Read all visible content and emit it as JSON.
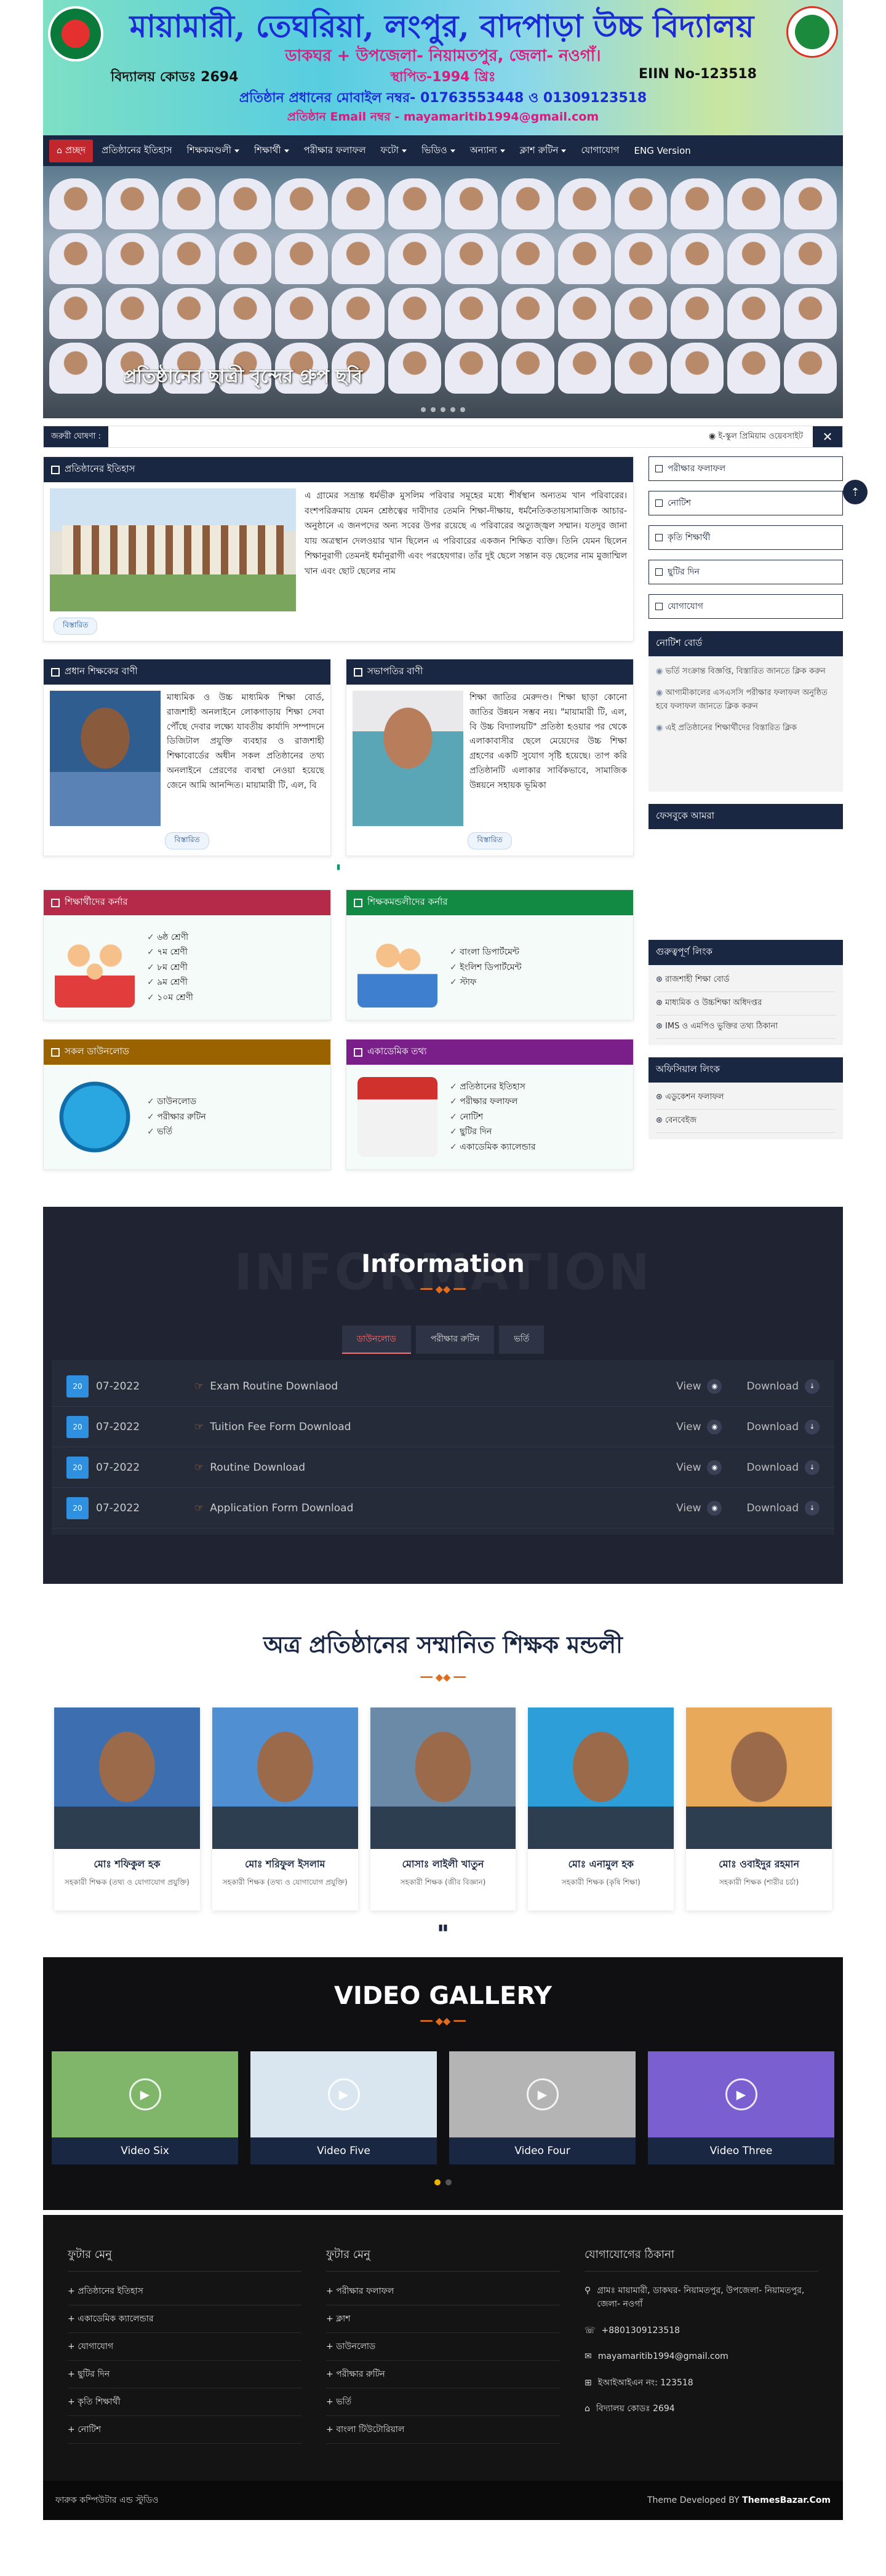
{
  "header": {
    "school_name": "মায়ামারী, তেঘরিয়া, লংপুর, বাদপাড়া উচ্চ বিদ্যালয়",
    "address": "ডাকঘর + উপজেলা- নিয়ামতপুর, জেলা- নওগাঁ।",
    "school_code": "বিদ্যালয় কোডঃ 2694",
    "established": "স্থাপিত-1994 খ্রিঃ",
    "eiin": "EIIN No-123518",
    "mobile": "প্রতিষ্ঠান প্রধানের মোবাইল নম্বর- 01763553448 ও 01309123518",
    "email": "প্রতিষ্ঠান Email নম্বর - mayamaritib1994@gmail.com"
  },
  "nav": {
    "home": "প্রচ্ছদ",
    "items": [
      {
        "label": "প্রতিষ্ঠানের ইতিহাস",
        "caret": false
      },
      {
        "label": "শিক্ষকমণ্ডলী",
        "caret": true
      },
      {
        "label": "শিক্ষার্থী",
        "caret": true
      },
      {
        "label": "পরীক্ষার ফলাফল",
        "caret": false
      },
      {
        "label": "ফটো",
        "caret": true
      },
      {
        "label": "ভিডিও",
        "caret": true
      },
      {
        "label": "অন্যান্য",
        "caret": true
      },
      {
        "label": "ক্লাশ রুটিন",
        "caret": true
      },
      {
        "label": "যোগাযোগ",
        "caret": false
      },
      {
        "label": "ENG Version",
        "caret": false
      }
    ]
  },
  "slider": {
    "caption": "প্রতিষ্ঠানের ছাত্রী বৃন্দের গ্রুপ ছবি"
  },
  "ticker": {
    "label": "জরুরী ঘোষণা :",
    "text": "◉ ই-স্কুল প্রিমিয়াম ওয়েবসাইট",
    "close": "✕"
  },
  "history": {
    "title": "প্রতিষ্ঠানের ইতিহাস",
    "text": "এ গ্রামের সভ্রান্ত ধর্মভীরু মুসলিম পরিবার সমূহের মধ্যে শীর্ষস্থান অন্যতম খান পরিবারের। বংশপরিক্রমায় যেমন শ্রেষ্ঠত্বের দাবীদার তেমনি শিক্ষা-দীক্ষায়, ধর্মনৈতিকতায়সামাজিক আচার-অনুষ্ঠানে এ জনপদের অন্য সবের উপর রয়েছে এ পরিবারের অত্যুজ্জ্বল সম্মান। যতদুর জানা যায় অত্রস্থান দেলওয়ার খান ছিলেন এ পরিবারের একজন শিক্ষিত ব্যক্তি। তিনি যেমন ছিলেন শিক্ষানুরাগী তেমনই ধর্মানুরাগী এবং পরহেযগার। তাঁর দুই ছেলে সন্তান বড় ছেলের নাম মুজাম্মিল খান এবং ছোট ছেলের নাম",
    "more": "বিস্তারিত"
  },
  "head_message": {
    "title": "প্রধান শিক্ষকের বাণী",
    "text": "মাধ্যমিক ও উচ্চ মাধ্যমিক শিক্ষা বোর্ড, রাজশাহী অনলাইনে লোকগাড়ায় শিক্ষা সেবা পৌঁছে দেবার লক্ষ্যে যাবতীয় কার্যাদি সম্পাদনে ডিজিটাল প্রযুক্তি ব্যবহার ও রাজশাহী শিক্ষাবোর্ডের অধীন সকল প্রতিষ্ঠানের তথ্য অনলাইনে প্রেরণের ব্যবস্থা নেওয়া হয়েছে জেনে আমি আনন্দিত। মায়ামারী টি, এল, বি",
    "more": "বিস্তারিত"
  },
  "chair_message": {
    "title": "সভাপতির বাণী",
    "text": "শিক্ষা জাতির মেরুদণ্ড। শিক্ষা ছাড়া কোনো জাতির উন্নয়ন সম্ভব নয়। \"মায়ামারী টি, এল, বি উচ্চ বিদ্যালয়টি\" প্রতিষ্ঠা হওয়ার পর থেকে এলাকাবাসীর ছেলে মেয়েদের উচ্চ শিক্ষা গ্রহণের একটি সুযোগ সৃষ্টি হয়েছে। তাপ করি প্রতিষ্ঠানটি এলাকার সার্বিকভাবে, সামাজিক উন্নয়নে সহায়ক ভূমিকা",
    "more": "বিস্তারিত"
  },
  "categories": [
    {
      "title": "শিক্ষার্থীদের কর্নার",
      "color": "#b52a48",
      "graphic": "students-icon",
      "items": [
        "৬ষ্ঠ শ্রেণী",
        "৭ম শ্রেণী",
        "৮ম শ্রেণী",
        "৯ম শ্রেণী",
        "১০ম শ্রেণী"
      ]
    },
    {
      "title": "শিক্ষকমন্ডলীদের কর্নার",
      "color": "#128a44",
      "graphic": "teachers-icon",
      "items": [
        "বাংলা ডিপার্টমেন্ট",
        "ইংলিশ ডিপার্টমেন্ট",
        "স্টাফ"
      ]
    },
    {
      "title": "সকল ডাউনলোড",
      "color": "#9a6300",
      "graphic": "download-icon",
      "items": [
        "ডাউনলোড",
        "পরীক্ষার রুটিন",
        "ভর্তি"
      ]
    },
    {
      "title": "একাডেমিক তথ্য",
      "color": "#7a1f8a",
      "graphic": "calendar-icon",
      "items": [
        "প্রতিষ্ঠানের ইতিহাস",
        "পরীক্ষার ফলাফল",
        "নোটিশ",
        "ছুটির দিন",
        "একাডেমিক ক্যালেন্ডার"
      ]
    }
  ],
  "sidebar": {
    "links": [
      "পরীক্ষার ফলাফল",
      "নোটিশ",
      "কৃতি শিক্ষার্থী",
      "ছুটির দিন",
      "যোগাযোগ"
    ],
    "notice_title": "নোটিশ বোর্ড",
    "notices": [
      "ভর্তি সংক্রান্ত বিজ্ঞপ্তি, বিস্তারিত জানতে ক্লিক করুন",
      "আগামীকালের এসএসসি পরীক্ষার ফলাফল অনুষ্ঠিত হবে ফলাফল জানতে ক্লিক করুন",
      "এই প্রতিষ্ঠানের শিক্ষার্থীদের বিস্তারিত ক্লিক"
    ],
    "facebook_title": "ফেসবুকে আমরা",
    "important_title": "গুরুত্বপূর্ণ লিংক",
    "important": [
      "রাজশাহী শিক্ষা বোর্ড",
      "মাধ্যমিক ও উচ্চশিক্ষা অধিদপ্তর",
      "IMS ও এমপিও ভুক্তির তথ্য ঠিকানা"
    ],
    "official_title": "অফিসিয়াল লিংক",
    "official": [
      "এডুকেশন ফলাফল",
      "বেনবেইজ"
    ]
  },
  "info": {
    "watermark": "INFORMATION",
    "title": "Information",
    "tabs": [
      "ডাউনলোড",
      "পরীক্ষার রুটিন",
      "ভর্তি"
    ],
    "calendar_label": "20",
    "view": "View",
    "download": "Download",
    "rows": [
      {
        "date": "07-2022",
        "name": "Exam Routine Downlaod"
      },
      {
        "date": "07-2022",
        "name": "Tuition Fee Form Download"
      },
      {
        "date": "07-2022",
        "name": "Routine Download"
      },
      {
        "date": "07-2022",
        "name": "Application Form Download"
      }
    ]
  },
  "teachers": {
    "title": "অত্র প্রতিষ্ঠানের সম্মানিত শিক্ষক মন্ডলী",
    "list": [
      {
        "name": "মোঃ শফিকুল হক",
        "role": "সহকারী শিক্ষক (তথ্য ও যোগাযোগ প্রযুক্তি)",
        "bg": "#3d6fb0"
      },
      {
        "name": "মোঃ শরিফুল ইসলাম",
        "role": "সহকারী শিক্ষক (তথ্য ও যোগাযোগ প্রযুক্তি)",
        "bg": "#4f8fd2"
      },
      {
        "name": "মোসাঃ লাইলী খাতুন",
        "role": "সহকারী শিক্ষক (জীব বিজ্ঞান)",
        "bg": "#6a8aa8"
      },
      {
        "name": "মোঃ এনামুল হক",
        "role": "সহকারী শিক্ষক (কৃষি শিক্ষা)",
        "bg": "#2e9ed8"
      },
      {
        "name": "মোঃ ওবাইদুর রহমান",
        "role": "সহকারী শিক্ষক (শারীর চর্চা)",
        "bg": "#e8a95a"
      }
    ]
  },
  "video": {
    "title": "VIDEO GALLERY",
    "items": [
      {
        "label": "Video Six",
        "bg": "#7fb66a"
      },
      {
        "label": "Video Five",
        "bg": "#d9e6ef"
      },
      {
        "label": "Video Four",
        "bg": "#b4b4b4"
      },
      {
        "label": "Video Three",
        "bg": "#7a5fd1"
      }
    ]
  },
  "footer": {
    "col1_title": "ফুটার মেনু",
    "col1": [
      "প্রতিষ্ঠানের ইতিহাস",
      "একাডেমিক ক্যালেন্ডার",
      "যোগাযোগ",
      "ছুটির দিন",
      "কৃতি শিক্ষার্থী",
      "নোটিশ"
    ],
    "col2_title": "ফুটার মেনু",
    "col2": [
      "পরীক্ষার ফলাফল",
      "ক্লাশ",
      "ডাউনলোড",
      "পরীক্ষার রুটিন",
      "ভর্তি",
      "বাংলা টিউটোরিয়াল"
    ],
    "col3_title": "যোগাযোগের ঠিকানা",
    "contacts": [
      {
        "icon": "⚲",
        "text": "গ্রামঃ মায়ামারী, ডাকঘর- নিয়ামতপুর, উপজেলা- নিয়ামতপুর, জেলা- নওগাঁ"
      },
      {
        "icon": "☏",
        "text": "+8801309123518"
      },
      {
        "icon": "✉",
        "text": "mayamaritib1994@gmail.com"
      },
      {
        "icon": "⊞",
        "text": "ইআইআইএন নং: 123518"
      },
      {
        "icon": "⌂",
        "text": "বিদ্যালয় কোডঃ 2694"
      }
    ],
    "copyright": "ফারুক কম্পিউটার এন্ড স্টুডিও",
    "developed": "Theme Developed BY",
    "brand": "ThemesBazar.Com"
  }
}
